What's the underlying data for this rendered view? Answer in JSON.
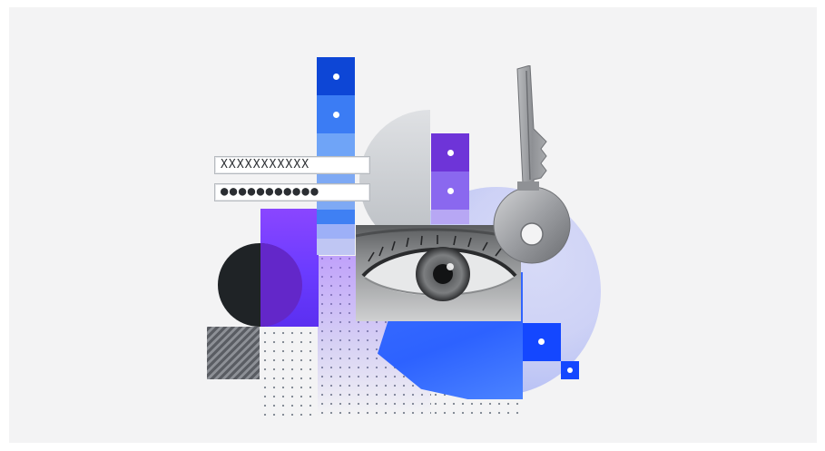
{
  "illustration": {
    "username_mask": "XXXXXXXXXXX",
    "password_mask": "●●●●●●●●●●●"
  },
  "icons": [
    "key-icon",
    "eye-photo"
  ],
  "colors": {
    "background": "#f3f3f4",
    "blue": "#1447ff",
    "purple": "#6e34d8",
    "dark": "#1f2326"
  }
}
